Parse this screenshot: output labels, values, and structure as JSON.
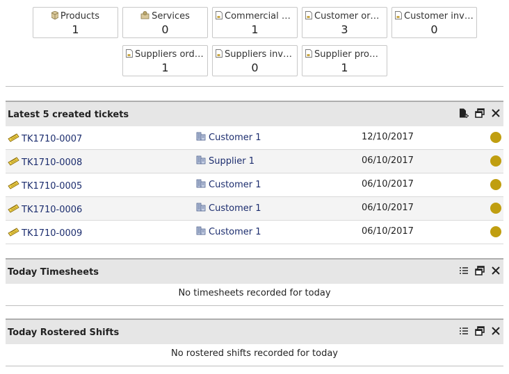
{
  "stats_row1": [
    {
      "label": "Products",
      "value": "1",
      "icon": "product-box-icon"
    },
    {
      "label": "Services",
      "value": "0",
      "icon": "service-icon"
    },
    {
      "label": "Commercial pr...",
      "value": "1",
      "icon": "document-icon"
    },
    {
      "label": "Customer orders",
      "value": "3",
      "icon": "document-icon"
    },
    {
      "label": "Customer invo...",
      "value": "0",
      "icon": "document-icon"
    }
  ],
  "stats_row2": [
    {
      "label": "Suppliers orders",
      "value": "1",
      "icon": "document-icon"
    },
    {
      "label": "Suppliers invo...",
      "value": "0",
      "icon": "document-icon"
    },
    {
      "label": "Supplier propo...",
      "value": "1",
      "icon": "document-icon"
    }
  ],
  "tickets_box": {
    "title": "Latest 5 created tickets",
    "actions": [
      "new-document-icon",
      "restore-window-icon",
      "close-icon"
    ],
    "rows": [
      {
        "ref": "TK1710-0007",
        "thirdparty": "Customer 1",
        "date": "12/10/2017",
        "status_color": "#c09e10"
      },
      {
        "ref": "TK1710-0008",
        "thirdparty": "Supplier 1",
        "date": "06/10/2017",
        "status_color": "#c09e10"
      },
      {
        "ref": "TK1710-0005",
        "thirdparty": "Customer 1",
        "date": "06/10/2017",
        "status_color": "#c09e10"
      },
      {
        "ref": "TK1710-0006",
        "thirdparty": "Customer 1",
        "date": "06/10/2017",
        "status_color": "#c09e10"
      },
      {
        "ref": "TK1710-0009",
        "thirdparty": "Customer 1",
        "date": "06/10/2017",
        "status_color": "#c09e10"
      }
    ]
  },
  "timesheets_box": {
    "title": "Today Timesheets",
    "empty_text": "No timesheets recorded for today",
    "actions": [
      "list-icon",
      "restore-window-icon",
      "close-icon"
    ]
  },
  "shifts_box": {
    "title": "Today Rostered Shifts",
    "empty_text": "No rostered shifts recorded for today",
    "actions": [
      "list-icon",
      "restore-window-icon",
      "close-icon"
    ]
  }
}
